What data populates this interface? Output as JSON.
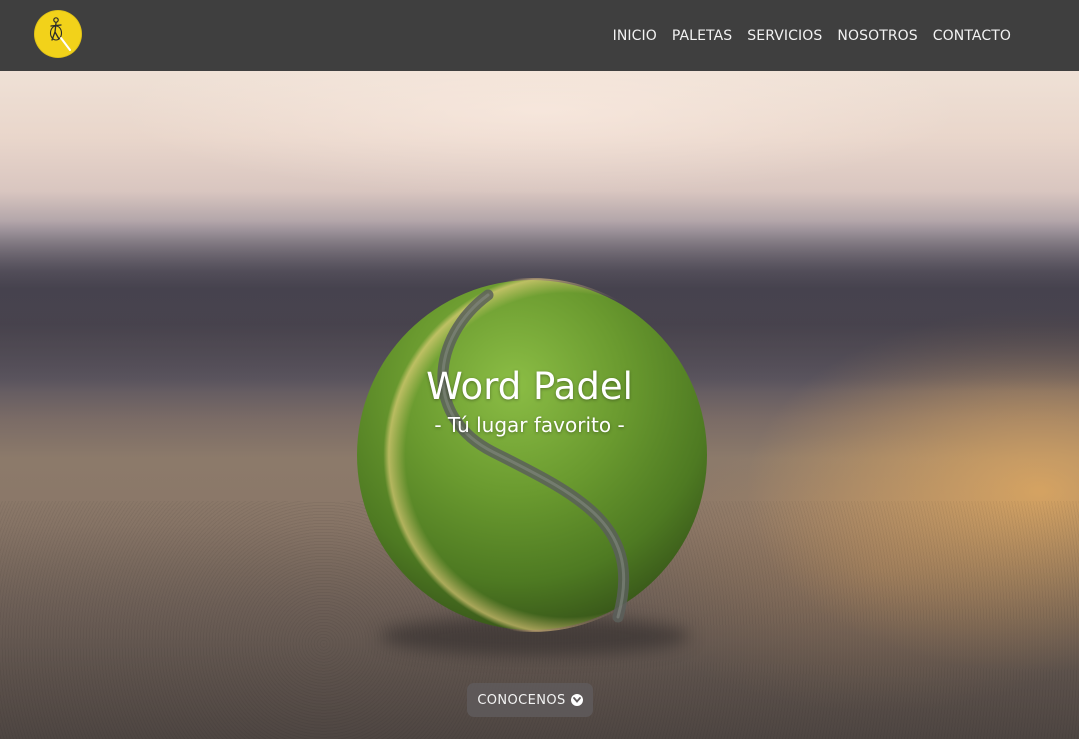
{
  "header": {
    "logo_icon": "padel-player-logo-icon",
    "nav": [
      {
        "label": "INICIO"
      },
      {
        "label": "PALETAS"
      },
      {
        "label": "SERVICIOS"
      },
      {
        "label": "NOSOTROS"
      },
      {
        "label": "CONTACTO"
      }
    ]
  },
  "hero": {
    "title": "Word Padel",
    "subtitle": "- Tú lugar favorito -",
    "cta_label": "CONOCENOS",
    "cta_icon": "chevron-down-circle-icon",
    "background_image": "tennis-ball-on-court-photo"
  },
  "colors": {
    "navbar": "#3f3f3f",
    "logo": "#f2d21a",
    "nav_text": "#f2f2f2",
    "ball": "#6a9a30"
  }
}
